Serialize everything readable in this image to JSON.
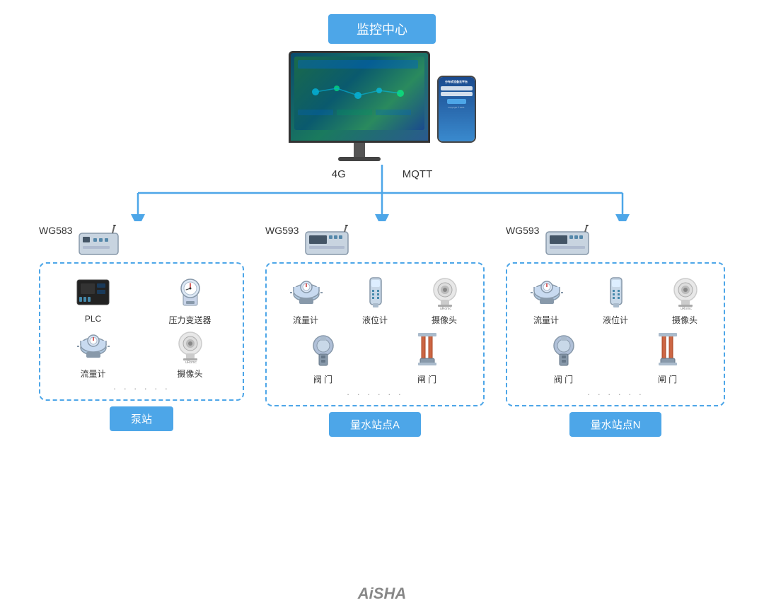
{
  "header": {
    "monitor_center": "监控中心"
  },
  "protocols": {
    "left": "4G",
    "right": "MQTT"
  },
  "stations": [
    {
      "id": "pump-station",
      "gateway_model": "WG583",
      "devices_row1": [
        {
          "name": "PLC",
          "type": "plc"
        },
        {
          "name": "压力变送器",
          "type": "pressure"
        }
      ],
      "devices_row2": [
        {
          "name": "流量计",
          "type": "flowmeter"
        },
        {
          "name": "摄像头",
          "type": "camera"
        }
      ],
      "badge": "泵站"
    },
    {
      "id": "water-station-a",
      "gateway_model": "WG593",
      "devices_row1": [
        {
          "name": "流量计",
          "type": "flowmeter"
        },
        {
          "name": "液位计",
          "type": "level"
        },
        {
          "name": "摄像头",
          "type": "camera"
        }
      ],
      "devices_row2": [
        {
          "name": "阀 门",
          "type": "valve"
        },
        {
          "name": "闸 门",
          "type": "gate"
        }
      ],
      "badge": "量水站点A"
    },
    {
      "id": "water-station-n",
      "gateway_model": "WG593",
      "devices_row1": [
        {
          "name": "流量计",
          "type": "flowmeter"
        },
        {
          "name": "液位计",
          "type": "level"
        },
        {
          "name": "摄像头",
          "type": "camera"
        }
      ],
      "devices_row2": [
        {
          "name": "阀 门",
          "type": "valve"
        },
        {
          "name": "闸 门",
          "type": "gate"
        }
      ],
      "badge": "量水站点N"
    }
  ],
  "footer": {
    "brand": "AiSHA"
  },
  "phone": {
    "title": "分布式设备云平台"
  }
}
